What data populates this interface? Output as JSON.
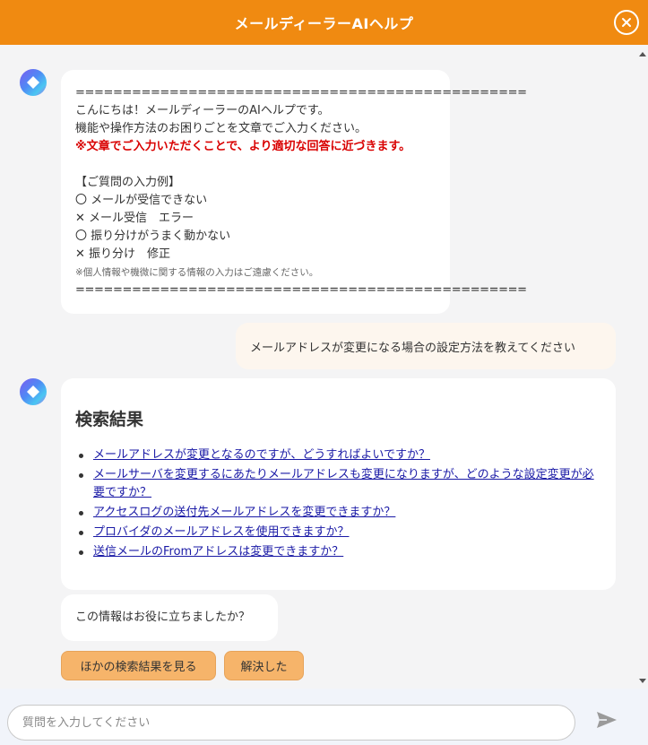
{
  "header": {
    "title": "メールディーラーAIヘルプ"
  },
  "welcome": {
    "separator": "================================================",
    "greeting": "こんにちは！メールディーラーのAIヘルプです。",
    "instruction": "機能や操作方法のお困りごとを文章でご入力ください。",
    "tip": "※文章でご入力いただくことで、より適切な回答に近づきます。",
    "examples_heading": "【ご質問の入力例】",
    "examples": [
      "〇 メールが受信できない",
      "✕ メール受信　エラー",
      "〇 振り分けがうまく動かない",
      "✕ 振り分け　修正"
    ],
    "note": "※個人情報や機微に関する情報の入力はご遠慮ください。"
  },
  "user_message": "メールアドレスが変更になる場合の設定方法を教えてください",
  "results": {
    "title": "検索結果",
    "links": [
      "メールアドレスが変更となるのですが、どうすればよいですか？",
      "メールサーバを変更するにあたりメールアドレスも変更になりますが、どのような設定変更が必要ですか？",
      "アクセスログの送付先メールアドレスを変更できますか？",
      "プロバイダのメールアドレスを使用できますか？",
      "送信メールのFromアドレスは変更できますか？"
    ]
  },
  "feedback": {
    "question": "この情報はお役に立ちましたか？",
    "more_label": "ほかの検索結果を見る",
    "resolved_label": "解決した"
  },
  "input": {
    "placeholder": "質問を入力してください"
  },
  "icons": {
    "close": "close-icon",
    "avatar": "ai-assistant-icon",
    "send": "send-icon"
  },
  "colors": {
    "header": "#f08a11",
    "button": "#f6b46a",
    "link": "#1a1aa6",
    "tip": "#d90000"
  }
}
